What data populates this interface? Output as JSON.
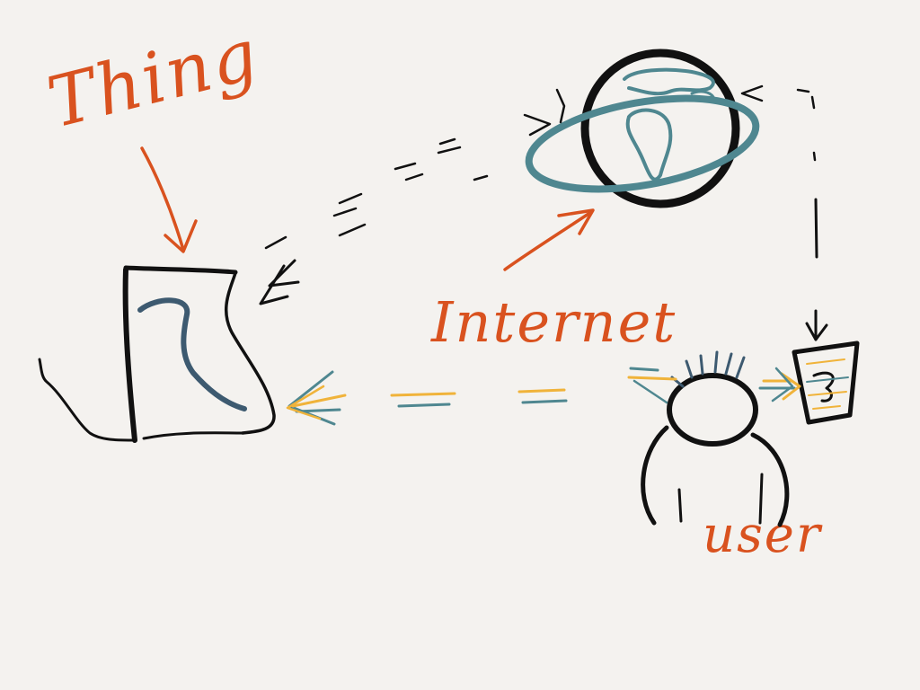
{
  "labels": {
    "thing": "Thing",
    "internet": "Internet",
    "user": "user"
  },
  "colors": {
    "background": "#f4f2ef",
    "label": "#d9521f",
    "ink": "#111111",
    "teal": "#4f8790",
    "slate": "#3d5a70",
    "yellow": "#f0b33a"
  },
  "nodes": [
    {
      "id": "thing",
      "icon": "device-icon"
    },
    {
      "id": "internet",
      "icon": "globe-icon"
    },
    {
      "id": "user",
      "icon": "person-icon"
    },
    {
      "id": "user-device",
      "icon": "small-device-icon"
    }
  ],
  "connections": [
    {
      "from": "internet",
      "to": "thing",
      "style": "dashed"
    },
    {
      "from": "internet",
      "to": "user-device",
      "style": "dashed"
    },
    {
      "from": "user",
      "to": "thing",
      "style": "dashed"
    },
    {
      "from": "user",
      "to": "user-device",
      "style": "dashed"
    }
  ]
}
